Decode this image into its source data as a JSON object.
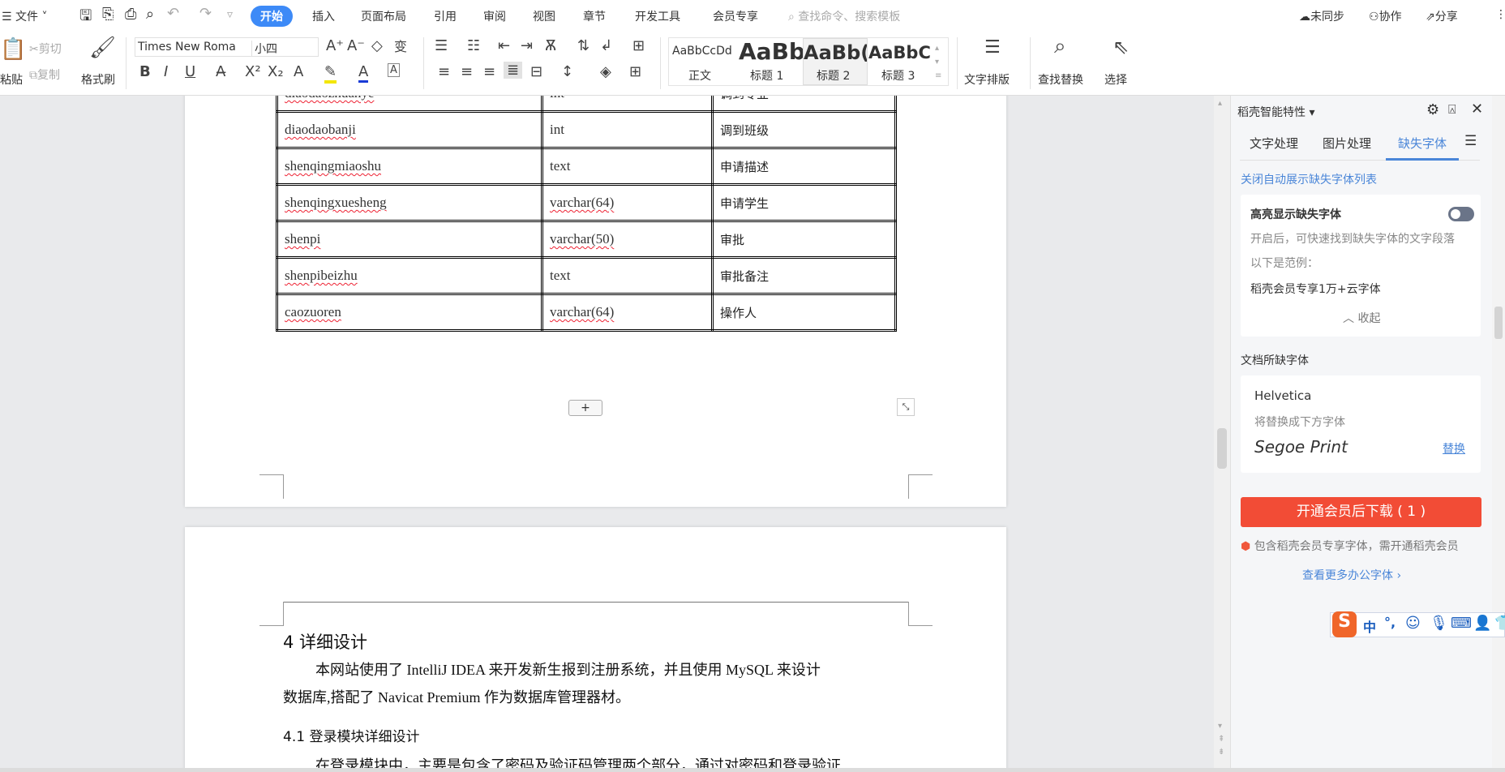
{
  "menubar": {
    "file": "文件",
    "tabs": [
      "开始",
      "插入",
      "页面布局",
      "引用",
      "审阅",
      "视图",
      "章节",
      "开发工具",
      "会员专享"
    ],
    "search_placeholder": "查找命令、搜索模板",
    "sync": "未同步",
    "collab": "协作",
    "share": "分享"
  },
  "toolbar": {
    "paste": "粘贴",
    "cut": "剪切",
    "copy": "复制",
    "format_painter": "格式刷",
    "font_name": "Times New Roma",
    "font_size": "小四",
    "styles": [
      {
        "preview": "AaBbCcDd",
        "label": "正文"
      },
      {
        "preview": "AaBb",
        "label": "标题 1"
      },
      {
        "preview": "AaBb(",
        "label": "标题 2"
      },
      {
        "preview": "AaBbC(",
        "label": "标题 3"
      }
    ],
    "text_layout": "文字排版",
    "find_replace": "查找替换",
    "select": "选择"
  },
  "table": {
    "rows": [
      [
        "diaodaozhuanye",
        "int",
        "调到专业"
      ],
      [
        "diaodaobanji",
        "int",
        "调到班级"
      ],
      [
        "shenqingmiaoshu",
        "text",
        "申请描述"
      ],
      [
        "shenqingxuesheng",
        "varchar(64)",
        "申请学生"
      ],
      [
        "shenpi",
        "varchar(50)",
        "审批"
      ],
      [
        "shenpibeizhu",
        "text",
        "审批备注"
      ],
      [
        "caozuoren",
        "varchar(64)",
        "操作人"
      ]
    ],
    "add_row": "+"
  },
  "page2": {
    "heading": "4  详细设计",
    "para1_line1": "本网站使用了  IntelliJ IDEA  来开发新生报到注册系统，并且使用  MySQL  来设计",
    "para1_line2": "数据库,搭配了  Navicat Premium  作为数据库管理器材。",
    "subheading": "4.1  登录模块详细设计",
    "para2_line1": "在登录模块中，主要是包含了密码及验证码管理两个部分，通过对密码和登录验证"
  },
  "panel": {
    "title": "稻壳智能特性",
    "tabs": [
      "文字处理",
      "图片处理",
      "缺失字体"
    ],
    "active_tab": "缺失字体",
    "close_auto_link": "关闭自动展示缺失字体列表",
    "highlight_title": "高亮显示缺失字体",
    "highlight_on": false,
    "highlight_desc": "开启后，可快速找到缺失字体的文字段落",
    "example_label": "以下是范例：",
    "example_text": "稻壳会员专享1万+云字体",
    "collapse": "收起",
    "missing_heading": "文档所缺字体",
    "missing_font": "Helvetica",
    "replace_hint": "将替换成下方字体",
    "replacement_font": "Segoe Print",
    "replace_btn": "替换",
    "download_btn": "开通会员后下载 ( 1 )",
    "member_notice": "包含稻壳会员专享字体，需开通稻壳会员",
    "more_fonts": "查看更多办公字体",
    "accent": "#4a86d8",
    "button_color": "#f24c36"
  },
  "ime": {
    "lang": "中",
    "punct": "°,"
  }
}
